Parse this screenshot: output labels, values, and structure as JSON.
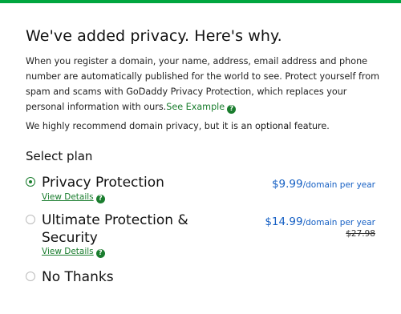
{
  "heading": "We've added privacy. Here's why.",
  "intro": {
    "text": "When you register a domain, your name, address, email address and phone number are automatically published for the world to see. Protect yourself from spam and scams with GoDaddy Privacy Protection, which replaces your personal information with ours.",
    "link": "See Example"
  },
  "recommend": {
    "before": "We highly recommend domain privacy, but it is an ",
    "emphasis": "optional",
    "after": " feature."
  },
  "select_plan_label": "Select plan",
  "plans": [
    {
      "name": "Privacy Protection",
      "details": "View Details",
      "price": "$9.99",
      "unit": "/domain per year",
      "selected": true
    },
    {
      "name_line1": "Ultimate Protection &",
      "name_line2": "Security",
      "details": "View Details",
      "price": "$14.99",
      "unit": "/domain per year",
      "old_price": "$27.98",
      "selected": false
    },
    {
      "name": "No Thanks",
      "selected": false
    }
  ],
  "help_glyph": "?",
  "colors": {
    "accent_green": "#1a7d2e",
    "top_bar": "#00a63f",
    "price_blue": "#1660c4"
  }
}
